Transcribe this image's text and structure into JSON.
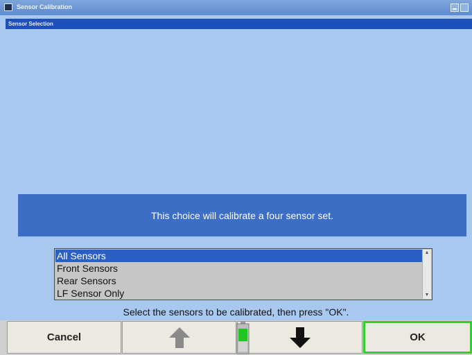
{
  "window": {
    "title": "Sensor Calibration"
  },
  "panel": {
    "title": "Sensor Selection"
  },
  "message": "This choice will calibrate a four sensor set.",
  "sensor_list": {
    "items": [
      {
        "label": "All Sensors",
        "selected": true
      },
      {
        "label": "Front Sensors",
        "selected": false
      },
      {
        "label": "Rear Sensors",
        "selected": false
      },
      {
        "label": "LF Sensor Only",
        "selected": false
      }
    ]
  },
  "instruction": "Select the sensors to be calibrated, then press \"OK\".",
  "buttons": {
    "cancel": "Cancel",
    "up": "up-arrow-icon",
    "down": "down-arrow-icon",
    "ok": "OK"
  },
  "colors": {
    "background": "#a9c8f0",
    "banner": "#3d6ec5",
    "selection": "#2c5fc4",
    "ok_border": "#2fcf2f",
    "battery": "#22c522"
  },
  "battery_icon": "battery-icon"
}
